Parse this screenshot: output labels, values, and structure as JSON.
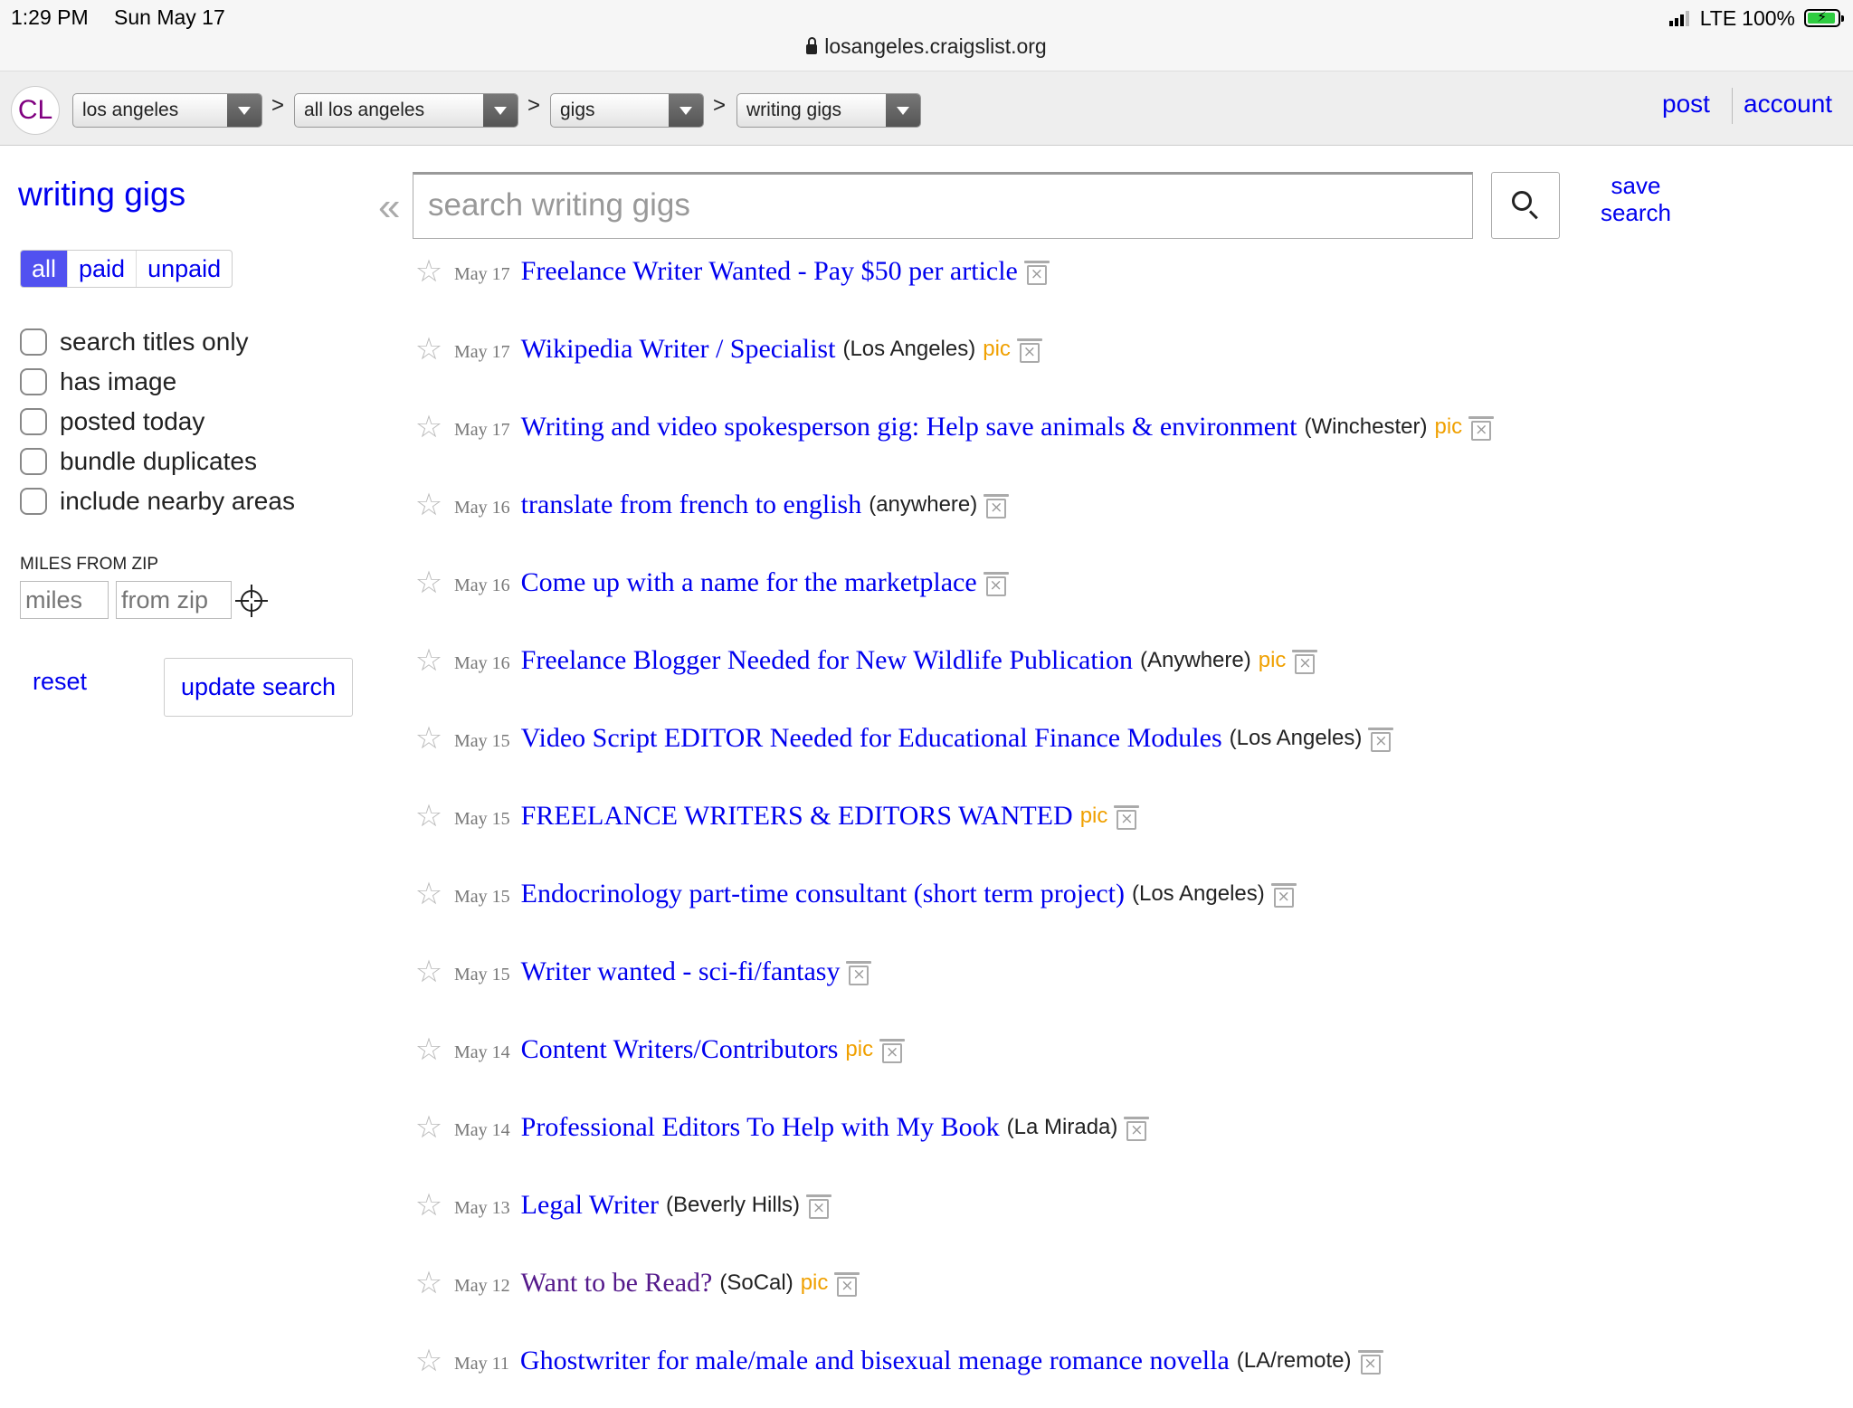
{
  "status_bar": {
    "time": "1:29 PM",
    "date": "Sun May 17",
    "network": "LTE",
    "battery": "100%",
    "battery_level": 1.0,
    "url": "losangeles.craigslist.org"
  },
  "header": {
    "logo": "CL",
    "breadcrumbs": [
      {
        "label": "los angeles"
      },
      {
        "label": "all los angeles"
      },
      {
        "label": "gigs"
      },
      {
        "label": "writing gigs"
      }
    ],
    "separator": ">",
    "post_label": "post",
    "account_label": "account"
  },
  "sidebar": {
    "title": "writing gigs",
    "filters": [
      "all",
      "paid",
      "unpaid"
    ],
    "active_filter": "all",
    "options": [
      {
        "label": "search titles only",
        "checked": false
      },
      {
        "label": "has image",
        "checked": false
      },
      {
        "label": "posted today",
        "checked": false
      },
      {
        "label": "bundle duplicates",
        "checked": false
      },
      {
        "label": "include nearby areas",
        "checked": false
      }
    ],
    "miles_label": "MILES FROM ZIP",
    "miles_placeholder": "miles",
    "zip_placeholder": "from zip",
    "reset_label": "reset",
    "update_label": "update search"
  },
  "search": {
    "collapse_glyph": "«",
    "placeholder": "search writing gigs",
    "save_label_line1": "save",
    "save_label_line2": "search"
  },
  "listings": [
    {
      "date": "May 17",
      "title": "Freelance Writer Wanted - Pay $50 per article",
      "hood": "",
      "pic": ""
    },
    {
      "date": "May 17",
      "title": "Wikipedia Writer / Specialist",
      "hood": "(Los Angeles)",
      "pic": "pic"
    },
    {
      "date": "May 17",
      "title": "Writing and video spokesperson gig: Help save animals & environment",
      "hood": "(Winchester)",
      "pic": "pic"
    },
    {
      "date": "May 16",
      "title": "translate from french to english",
      "hood": "(anywhere)",
      "pic": ""
    },
    {
      "date": "May 16",
      "title": "Come up with a name for the marketplace",
      "hood": "",
      "pic": ""
    },
    {
      "date": "May 16",
      "title": "Freelance Blogger Needed for New Wildlife Publication",
      "hood": "(Anywhere)",
      "pic": "pic"
    },
    {
      "date": "May 15",
      "title": "Video Script EDITOR Needed for Educational Finance Modules",
      "hood": "(Los Angeles)",
      "pic": ""
    },
    {
      "date": "May 15",
      "title": "FREELANCE WRITERS & EDITORS WANTED",
      "hood": "",
      "pic": "pic"
    },
    {
      "date": "May 15",
      "title": "Endocrinology part-time consultant (short term project)",
      "hood": "(Los Angeles)",
      "pic": ""
    },
    {
      "date": "May 15",
      "title": "Writer wanted - sci-fi/fantasy",
      "hood": "",
      "pic": ""
    },
    {
      "date": "May 14",
      "title": "Content Writers/Contributors",
      "hood": "",
      "pic": "pic"
    },
    {
      "date": "May 14",
      "title": "Professional Editors To Help with My Book",
      "hood": "(La Mirada)",
      "pic": ""
    },
    {
      "date": "May 13",
      "title": "Legal Writer",
      "hood": "(Beverly Hills)",
      "pic": ""
    },
    {
      "date": "May 12",
      "title": "Want to be Read?",
      "hood": "(SoCal)",
      "pic": "pic",
      "visited": true
    },
    {
      "date": "May 11",
      "title": "Ghostwriter for male/male and bisexual menage romance novella",
      "hood": "(LA/remote)",
      "pic": ""
    }
  ],
  "colors": {
    "link": "#0000ee",
    "visited_link": "#551a8b",
    "pic_tag": "#f0a000",
    "active_filter": "#5151f0"
  }
}
